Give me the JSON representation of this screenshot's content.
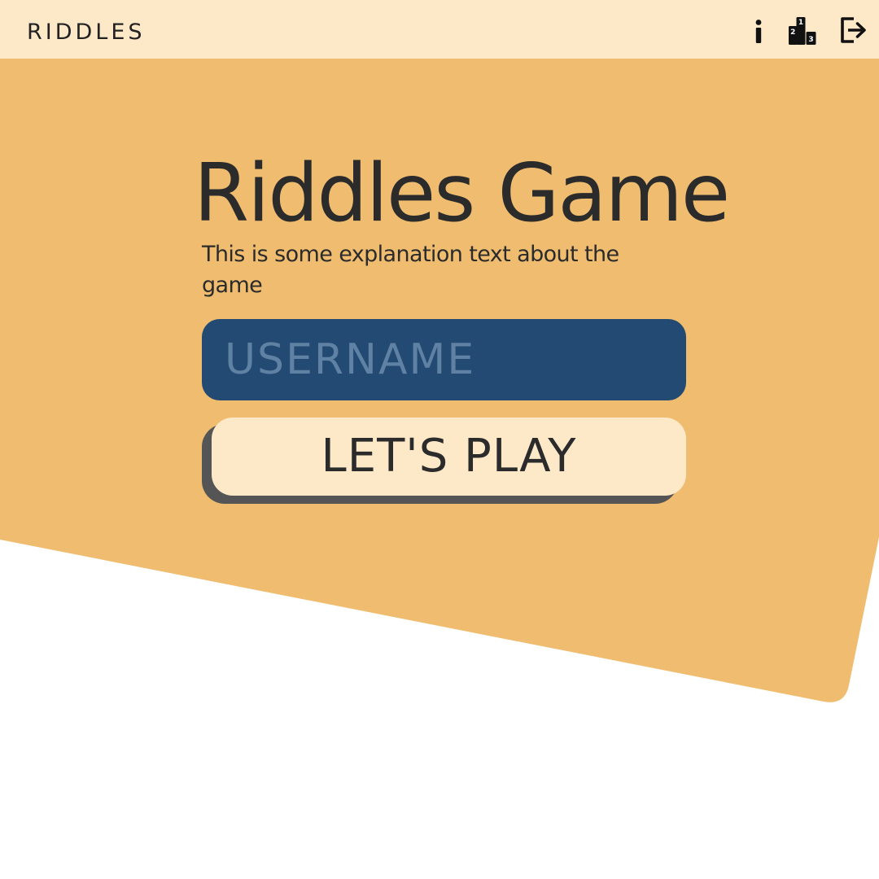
{
  "colors": {
    "background": "#ffffff",
    "panel": "#f0bd70",
    "topbar": "#fde9c8",
    "input": "#234a72",
    "input_placeholder": "#5f81a3",
    "button": "#fde9c8",
    "button_shadow": "#555555",
    "text": "#2b2b2b"
  },
  "topbar": {
    "brand": "RIDDLES",
    "icons": [
      "info-icon",
      "podium-icon",
      "logout-icon"
    ],
    "podium_ranks": [
      "1",
      "2",
      "3"
    ]
  },
  "main": {
    "title": "Riddles Game",
    "subtitle": "This is some explanation text about the game",
    "username_placeholder": "USERNAME",
    "username_value": "",
    "play_label": "LET'S PLAY"
  }
}
